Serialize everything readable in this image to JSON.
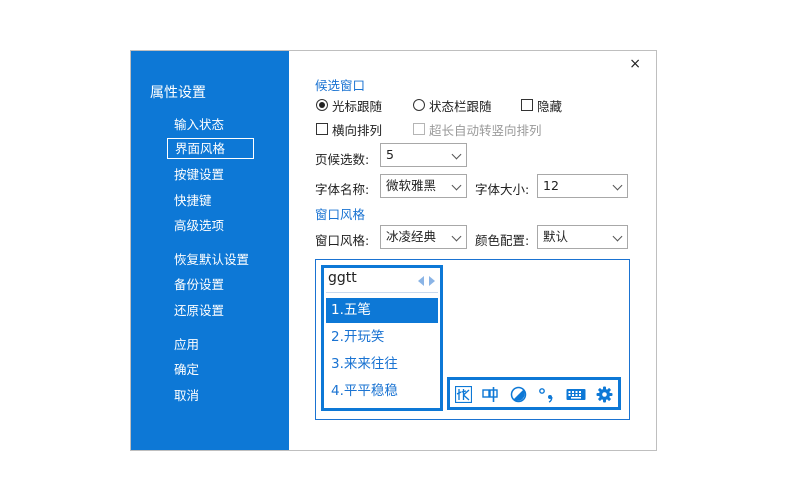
{
  "sidebar": {
    "title": "属性设置",
    "items": [
      {
        "label": "输入状态"
      },
      {
        "label": "界面风格"
      },
      {
        "label": "按键设置"
      },
      {
        "label": "快捷键"
      },
      {
        "label": "高级选项"
      },
      {
        "label": "恢复默认设置"
      },
      {
        "label": "备份设置"
      },
      {
        "label": "还原设置"
      },
      {
        "label": "应用"
      },
      {
        "label": "确定"
      },
      {
        "label": "取消"
      }
    ]
  },
  "window": {
    "close_label": "×"
  },
  "candidate_window": {
    "section_label": "候选窗口",
    "follow_options": [
      {
        "label": "光标跟随",
        "checked": true
      },
      {
        "label": "状态栏跟随",
        "checked": false
      }
    ],
    "hide_label": "隐藏",
    "horizontal_label": "横向排列",
    "auto_vertical_label": "超长自动转竖向排列",
    "per_page_label": "页候选数:",
    "per_page_value": "5",
    "font_name_label": "字体名称:",
    "font_name_value": "微软雅黑",
    "font_size_label": "字体大小:",
    "font_size_value": "12"
  },
  "window_style": {
    "section_label": "窗口风格",
    "style_label": "窗口风格:",
    "style_value": "冰凌经典",
    "color_label": "颜色配置:",
    "color_value": "默认"
  },
  "preview": {
    "input_text": "ggtt",
    "candidates": [
      "1.五笔",
      "2.开玩笑",
      "3.来来往往",
      "4.平平稳稳"
    ],
    "toolbar_icons": [
      "ice-logo-icon",
      "chinese-mode-icon",
      "skin-icon",
      "punctuation-icon",
      "keyboard-icon",
      "gear-icon"
    ]
  },
  "colors": {
    "accent": "#0d78d6",
    "section": "#1a73d2"
  }
}
